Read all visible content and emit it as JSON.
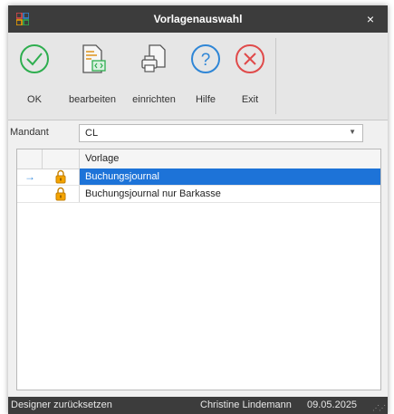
{
  "window": {
    "title": "Vorlagenauswahl",
    "close_symbol": "×"
  },
  "toolbar": {
    "ok_label": "OK",
    "edit_label": "bearbeiten",
    "setup_label": "einrichten",
    "help_label": "Hilfe",
    "exit_label": "Exit"
  },
  "filter": {
    "label": "Mandant",
    "value": "CL"
  },
  "grid": {
    "column_header": "Vorlage",
    "rows": [
      {
        "indicator": "→",
        "name": "Buchungsjournal"
      },
      {
        "indicator": "",
        "name": "Buchungsjournal nur Barkasse"
      }
    ]
  },
  "statusbar": {
    "reset_label": "Designer zurücksetzen",
    "user": "Christine Lindemann",
    "date": "09.05.2025"
  },
  "colors": {
    "titlebar": "#3c3c3c",
    "selection": "#1d73d8",
    "ok_green": "#2eae4f",
    "help_blue": "#2f86d6",
    "exit_red": "#e04a4a",
    "lock_orange": "#f5a400"
  }
}
